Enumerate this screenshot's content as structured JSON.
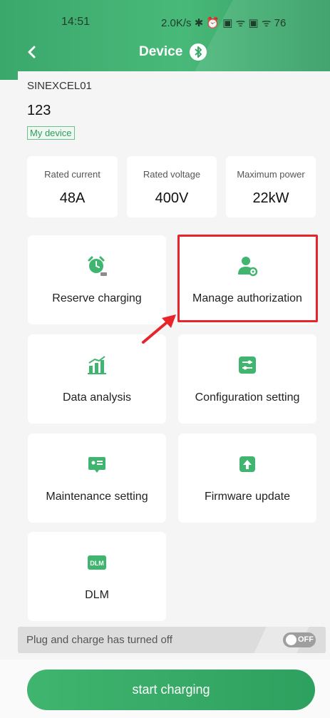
{
  "status_bar": {
    "time": "14:51",
    "right": "2.0K/s ✱ ⏰ ▣ ᯤ ▣ ᯤ 76"
  },
  "nav": {
    "back_icon": "back-chevron-icon",
    "title": "Device",
    "title_icon": "bluetooth-icon"
  },
  "device": {
    "name": "SINEXCEL01",
    "id": "123",
    "tag": "My device"
  },
  "specs": [
    {
      "label": "Rated current",
      "value": "48A"
    },
    {
      "label": "Rated voltage",
      "value": "400V"
    },
    {
      "label": "Maximum power",
      "value": "22kW"
    }
  ],
  "functions": [
    {
      "label": "Reserve charging",
      "icon": "alarm-clock-icon"
    },
    {
      "label": "Manage authorization",
      "icon": "user-settings-icon"
    },
    {
      "label": "Data analysis",
      "icon": "bar-chart-icon"
    },
    {
      "label": "Configuration setting",
      "icon": "sliders-icon"
    },
    {
      "label": "Maintenance setting",
      "icon": "maintenance-card-icon"
    },
    {
      "label": "Firmware update",
      "icon": "upload-arrow-icon"
    },
    {
      "label": "DLM",
      "icon": "dlm-icon"
    }
  ],
  "plug_and_charge": {
    "text": "Plug and charge has turned off",
    "toggle_label": "OFF"
  },
  "start_button": {
    "label": "start charging"
  },
  "colors": {
    "brand_green": "#3aa86b",
    "highlight_red": "#e8242a"
  }
}
